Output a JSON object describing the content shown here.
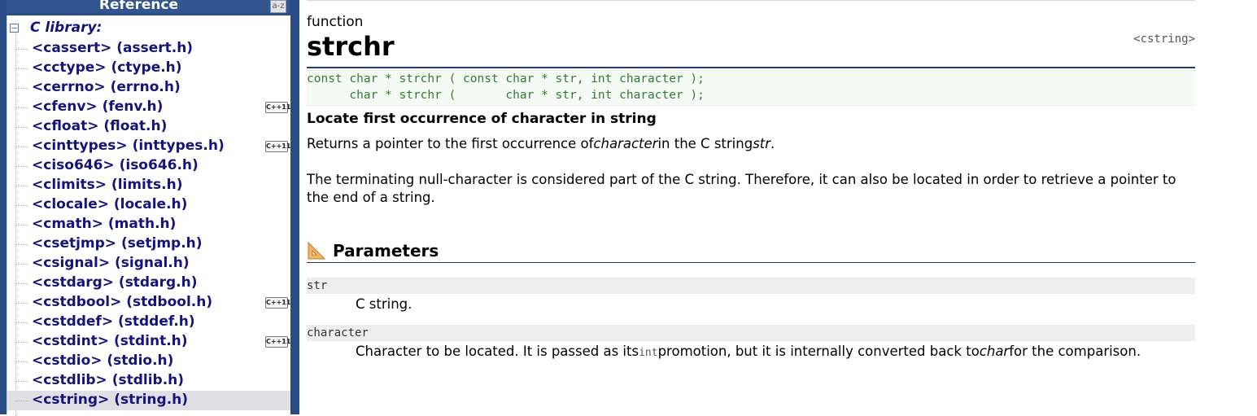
{
  "sidebar": {
    "title": "Reference",
    "az_icon": "a-z",
    "root_label": "C library:",
    "root_toggle": "−",
    "cpp_badge": "C++11",
    "items": [
      {
        "label": "<cassert> (assert.h)",
        "cpp11": false
      },
      {
        "label": "<cctype> (ctype.h)",
        "cpp11": false
      },
      {
        "label": "<cerrno> (errno.h)",
        "cpp11": false
      },
      {
        "label": "<cfenv> (fenv.h)",
        "cpp11": true
      },
      {
        "label": "<cfloat> (float.h)",
        "cpp11": false
      },
      {
        "label": "<cinttypes> (inttypes.h)",
        "cpp11": true
      },
      {
        "label": "<ciso646> (iso646.h)",
        "cpp11": false
      },
      {
        "label": "<climits> (limits.h)",
        "cpp11": false
      },
      {
        "label": "<clocale> (locale.h)",
        "cpp11": false
      },
      {
        "label": "<cmath> (math.h)",
        "cpp11": false
      },
      {
        "label": "<csetjmp> (setjmp.h)",
        "cpp11": false
      },
      {
        "label": "<csignal> (signal.h)",
        "cpp11": false
      },
      {
        "label": "<cstdarg> (stdarg.h)",
        "cpp11": false
      },
      {
        "label": "<cstdbool> (stdbool.h)",
        "cpp11": true
      },
      {
        "label": "<cstddef> (stddef.h)",
        "cpp11": false
      },
      {
        "label": "<cstdint> (stdint.h)",
        "cpp11": true
      },
      {
        "label": "<cstdio> (stdio.h)",
        "cpp11": false
      },
      {
        "label": "<cstdlib> (stdlib.h)",
        "cpp11": false
      },
      {
        "label": "<cstring> (string.h)",
        "cpp11": false,
        "selected": true
      }
    ]
  },
  "main": {
    "kind": "function",
    "name": "strchr",
    "header": "<cstring>",
    "prototypes": [
      "const char * strchr ( const char * str, int character );",
      "      char * strchr (       char * str, int character );"
    ],
    "description_title": "Locate first occurrence of character in string",
    "para1": {
      "before": "Returns a pointer to the first occurrence of",
      "em1": "character",
      "middle": "in the C string",
      "em2": "str",
      "after": "."
    },
    "para2": "The terminating null-character is considered part of the C string. Therefore, it can also be located in order to retrieve a pointer to the end of a string.",
    "parameters_title": "Parameters",
    "parameters": [
      {
        "name": "str",
        "desc": "C string."
      },
      {
        "name": "character",
        "desc_before": "Character to be located. It is passed as its",
        "desc_code": "int",
        "desc_middle": "promotion, but it is internally converted back to",
        "desc_em": "char",
        "desc_after": "for the comparison."
      }
    ]
  },
  "colors": {
    "sidebar_bg": "#2a4c84",
    "link": "#14147a",
    "code_green": "#2f7a2f",
    "rule": "#203c70"
  },
  "icons": [
    "a-z-sort-icon",
    "tree-collapse-icon",
    "ruler-triangle-icon",
    "cpp11-badge"
  ]
}
